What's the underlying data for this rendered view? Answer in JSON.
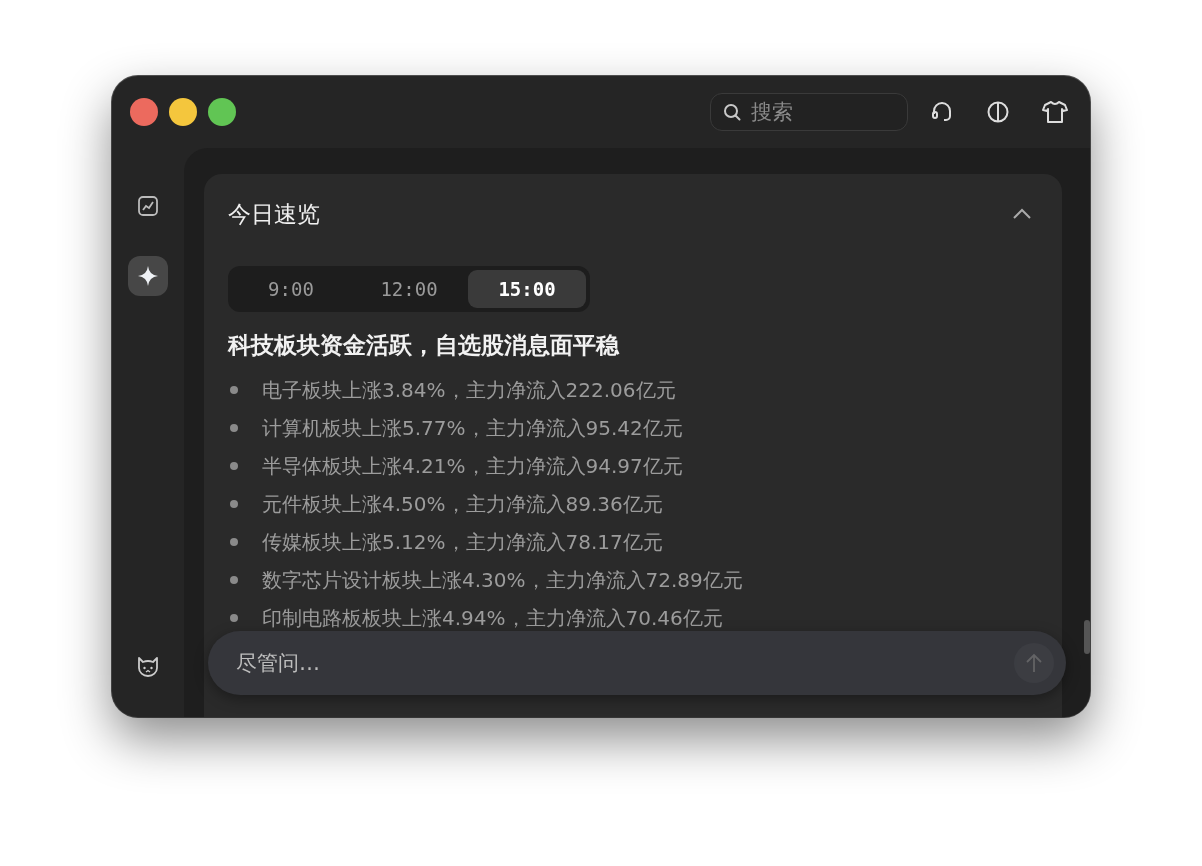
{
  "window": {
    "search": {
      "placeholder": "搜索"
    }
  },
  "sidebar": {
    "items": [
      {
        "selected": false
      },
      {
        "selected": true
      }
    ]
  },
  "card": {
    "title": "今日速览",
    "expanded": true,
    "time_tabs": [
      {
        "label": "9:00",
        "selected": false
      },
      {
        "label": "12:00",
        "selected": false
      },
      {
        "label": "15:00",
        "selected": true
      }
    ],
    "headline": "科技板块资金活跃，自选股消息面平稳",
    "bullets": [
      "电子板块上涨3.84%，主力净流入222.06亿元",
      "计算机板块上涨5.77%，主力净流入95.42亿元",
      "半导体板块上涨4.21%，主力净流入94.97亿元",
      "元件板块上涨4.50%，主力净流入89.36亿元",
      "传媒板块上涨5.12%，主力净流入78.17亿元",
      "数字芯片设计板块上涨4.30%，主力净流入72.89亿元",
      "印制电路板板块上涨4.94%，主力净流入70.46亿元"
    ]
  },
  "chat_input": {
    "placeholder": "尽管问…",
    "send_disabled": true
  }
}
